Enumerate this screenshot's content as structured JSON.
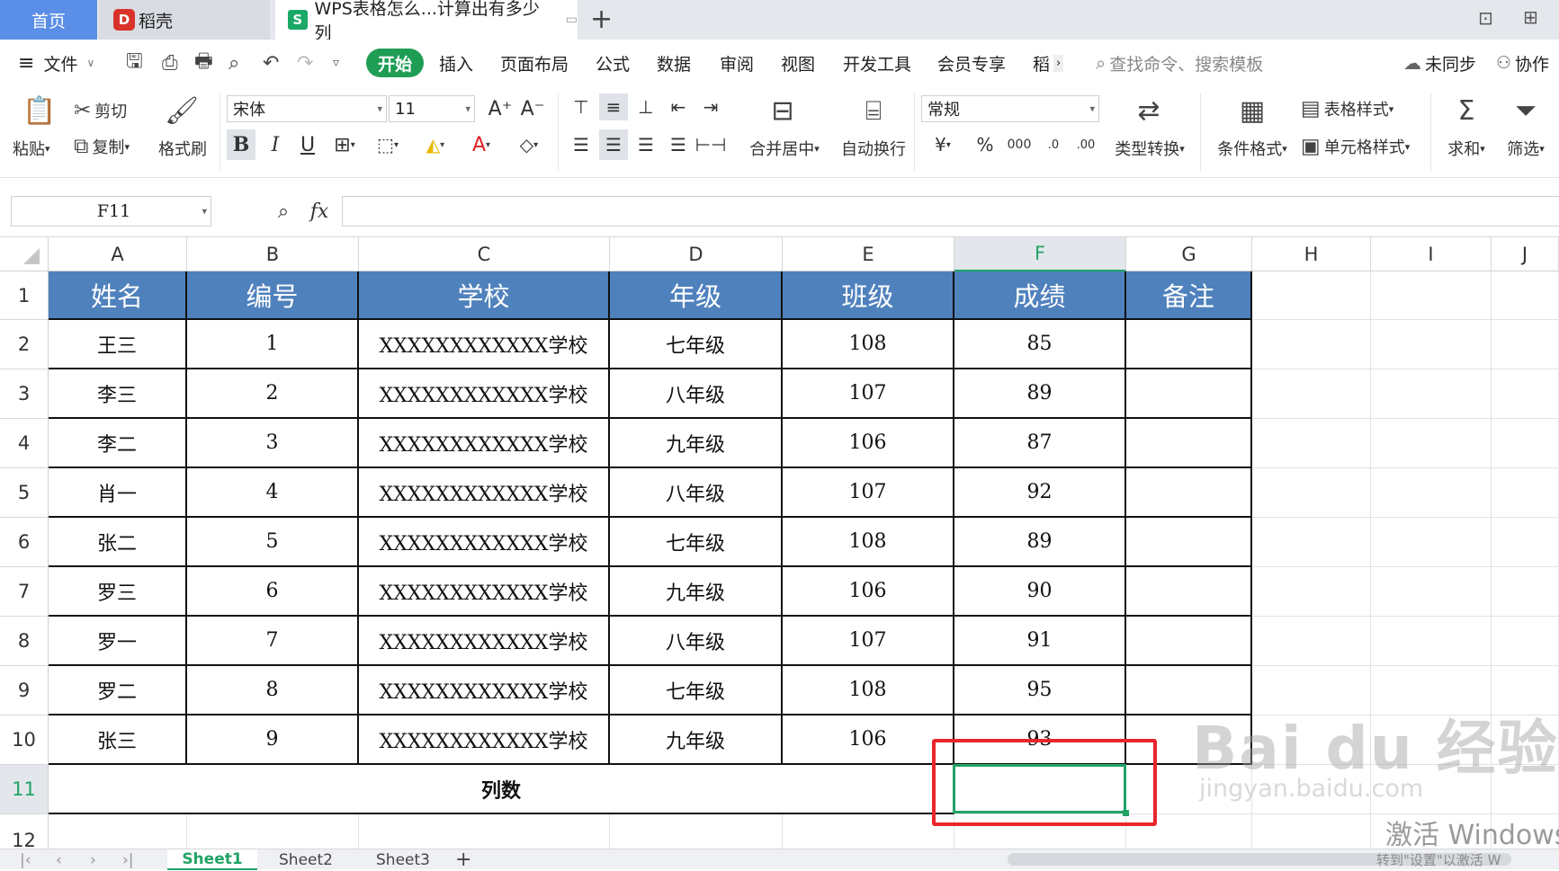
{
  "tabs": {
    "home": "首页",
    "daoke": "稻壳",
    "document": "WPS表格怎么...计算出有多少列"
  },
  "menu": {
    "file": "文件",
    "start": "开始",
    "insert": "插入",
    "page_layout": "页面布局",
    "formula": "公式",
    "data": "数据",
    "review": "审阅",
    "view": "视图",
    "developer": "开发工具",
    "member": "会员专享",
    "more": "稻",
    "search_placeholder": "查找命令、搜索模板",
    "sync": "未同步",
    "collab": "协作"
  },
  "ribbon": {
    "paste": "粘贴",
    "cut": "剪切",
    "copy": "复制",
    "format_painter": "格式刷",
    "font_name": "宋体",
    "font_size": "11",
    "merge_center": "合并居中",
    "wrap_text": "自动换行",
    "number_format": "常规",
    "type_convert": "类型转换",
    "conditional_format": "条件格式",
    "table_style": "表格样式",
    "cell_style": "单元格样式",
    "sum": "求和",
    "filter": "筛选"
  },
  "formula_bar": {
    "name_box": "F11",
    "fx": "fx",
    "content": ""
  },
  "columns": [
    "A",
    "B",
    "C",
    "D",
    "E",
    "F",
    "G",
    "H",
    "I",
    "J"
  ],
  "rows": [
    "1",
    "2",
    "3",
    "4",
    "5",
    "6",
    "7",
    "8",
    "9",
    "10",
    "11",
    "12"
  ],
  "table": {
    "headers": [
      "姓名",
      "编号",
      "学校",
      "年级",
      "班级",
      "成绩",
      "备注"
    ],
    "rows": [
      [
        "王三",
        "1",
        "XXXXXXXXXXXX学校",
        "七年级",
        "108",
        "85",
        ""
      ],
      [
        "李三",
        "2",
        "XXXXXXXXXXXX学校",
        "八年级",
        "107",
        "89",
        ""
      ],
      [
        "李二",
        "3",
        "XXXXXXXXXXXX学校",
        "九年级",
        "106",
        "87",
        ""
      ],
      [
        "肖一",
        "4",
        "XXXXXXXXXXXX学校",
        "八年级",
        "107",
        "92",
        ""
      ],
      [
        "张二",
        "5",
        "XXXXXXXXXXXX学校",
        "七年级",
        "108",
        "89",
        ""
      ],
      [
        "罗三",
        "6",
        "XXXXXXXXXXXX学校",
        "九年级",
        "106",
        "90",
        ""
      ],
      [
        "罗一",
        "7",
        "XXXXXXXXXXXX学校",
        "八年级",
        "107",
        "91",
        ""
      ],
      [
        "罗二",
        "8",
        "XXXXXXXXXXXX学校",
        "七年级",
        "108",
        "95",
        ""
      ],
      [
        "张三",
        "9",
        "XXXXXXXXXXXX学校",
        "九年级",
        "106",
        "93",
        ""
      ]
    ],
    "summary_label": "列数"
  },
  "sheets": [
    "Sheet1",
    "Sheet2",
    "Sheet3"
  ],
  "watermark": {
    "baidu": "Bai du 经验",
    "baidu_url": "jingyan.baidu.com",
    "activate": "激活 Windows",
    "activate_sub": "转到\"设置\"以激活 W"
  },
  "colors": {
    "accent_green": "#1f9d55",
    "header_fill": "#4f81bd",
    "highlight_box": "#e8262b",
    "home_tab": "#5b8ee6"
  }
}
